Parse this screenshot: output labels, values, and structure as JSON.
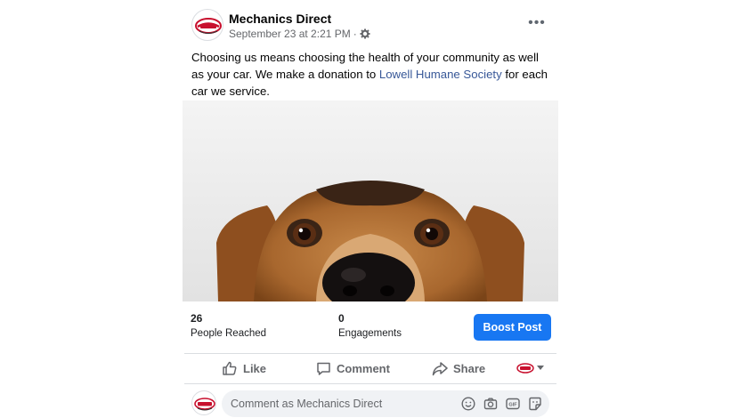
{
  "post": {
    "page_name": "Mechanics Direct",
    "timestamp": "September 23 at 2:21 PM",
    "separator": "·",
    "audience_icon": "gear-icon",
    "more_icon": "more-horizontal-icon",
    "more_label": "•••",
    "text_before": "Choosing us means choosing the health of your community as well as your car. We make a donation to ",
    "link_text": "Lowell Humane Society",
    "text_after": " for each car we service.",
    "photo_subject": "dog-photo"
  },
  "stats": {
    "reached_value": "26",
    "reached_label": "People Reached",
    "engagements_value": "0",
    "engagements_label": "Engagements",
    "boost_label": "Boost Post"
  },
  "actions": {
    "like_label": "Like",
    "comment_label": "Comment",
    "share_label": "Share"
  },
  "comment": {
    "placeholder": "Comment as Mechanics Direct",
    "icons": [
      "emoji-icon",
      "camera-icon",
      "gif-icon",
      "sticker-icon"
    ],
    "gif_label": "GIF"
  },
  "colors": {
    "brand_blue": "#1877f2",
    "link_blue": "#385898",
    "secondary_text": "#65676b",
    "logo_red": "#c8102e"
  }
}
